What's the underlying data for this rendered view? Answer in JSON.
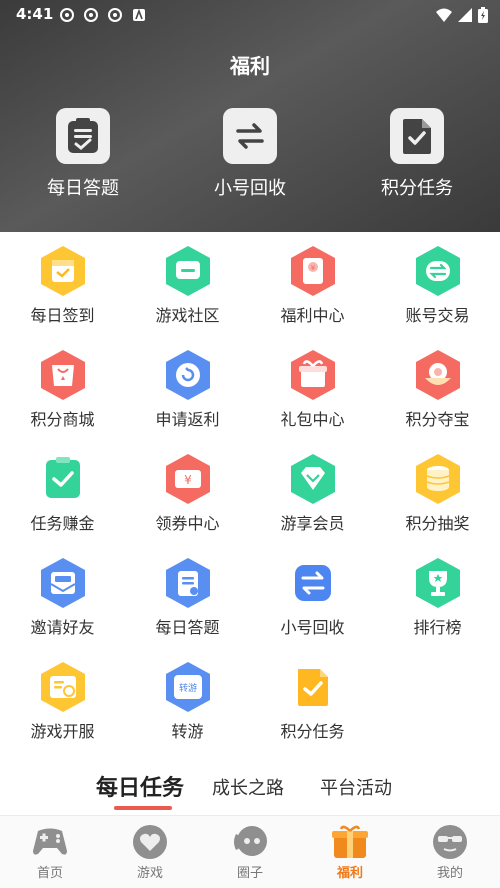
{
  "status": {
    "time": "4:41"
  },
  "header": {
    "title": "福利"
  },
  "top_tools": [
    {
      "label": "每日答题",
      "icon": "clipboard-icon"
    },
    {
      "label": "小号回收",
      "icon": "swap-icon"
    },
    {
      "label": "积分任务",
      "icon": "document-check-icon"
    }
  ],
  "grid": [
    {
      "label": "每日签到",
      "icon": "calendar-check-icon",
      "color": "#ffb820"
    },
    {
      "label": "游戏社区",
      "icon": "chat-icon",
      "color": "#2fcf8e"
    },
    {
      "label": "福利中心",
      "icon": "red-envelope-icon",
      "color": "#f3625a"
    },
    {
      "label": "账号交易",
      "icon": "exchange-icon",
      "color": "#2fcf8e"
    },
    {
      "label": "积分商城",
      "icon": "shopping-bag-icon",
      "color": "#f3625a"
    },
    {
      "label": "申请返利",
      "icon": "refund-icon",
      "color": "#4d86f0"
    },
    {
      "label": "礼包中心",
      "icon": "gift-icon",
      "color": "#f3625a"
    },
    {
      "label": "积分夺宝",
      "icon": "treasure-icon",
      "color": "#f3625a"
    },
    {
      "label": "任务赚金",
      "icon": "task-check-icon",
      "color": "#2fcf8e"
    },
    {
      "label": "领券中心",
      "icon": "coupon-icon",
      "color": "#f3625a"
    },
    {
      "label": "游享会员",
      "icon": "diamond-icon",
      "color": "#2fcf8e"
    },
    {
      "label": "积分抽奖",
      "icon": "coin-stack-icon",
      "color": "#ffb820"
    },
    {
      "label": "邀请好友",
      "icon": "invite-mail-icon",
      "color": "#4d86f0"
    },
    {
      "label": "每日答题",
      "icon": "clipboard-icon",
      "color": "#4d86f0"
    },
    {
      "label": "小号回收",
      "icon": "swap-icon",
      "color": "#4d86f0"
    },
    {
      "label": "排行榜",
      "icon": "trophy-icon",
      "color": "#2fcf8e"
    },
    {
      "label": "游戏开服",
      "icon": "server-clock-icon",
      "color": "#ffb820"
    },
    {
      "label": "转游",
      "icon": "transfer-game-icon",
      "color": "#4d86f0"
    },
    {
      "label": "积分任务",
      "icon": "document-check-icon",
      "color": "#ffb820"
    }
  ],
  "tabs": [
    {
      "label": "每日任务",
      "active": true
    },
    {
      "label": "成长之路",
      "active": false
    },
    {
      "label": "平台活动",
      "active": false
    }
  ],
  "bottom_nav": [
    {
      "label": "首页",
      "icon": "gamepad-icon"
    },
    {
      "label": "游戏",
      "icon": "heart-icon"
    },
    {
      "label": "圈子",
      "icon": "chat-bubble-icon"
    },
    {
      "label": "福利",
      "icon": "gift-box-icon",
      "active": true
    },
    {
      "label": "我的",
      "icon": "sunglasses-face-icon"
    }
  ],
  "colors": {
    "accent": "#ee7a1a",
    "tab_underline": "#ea5a4e",
    "header_bg": "#444444"
  }
}
